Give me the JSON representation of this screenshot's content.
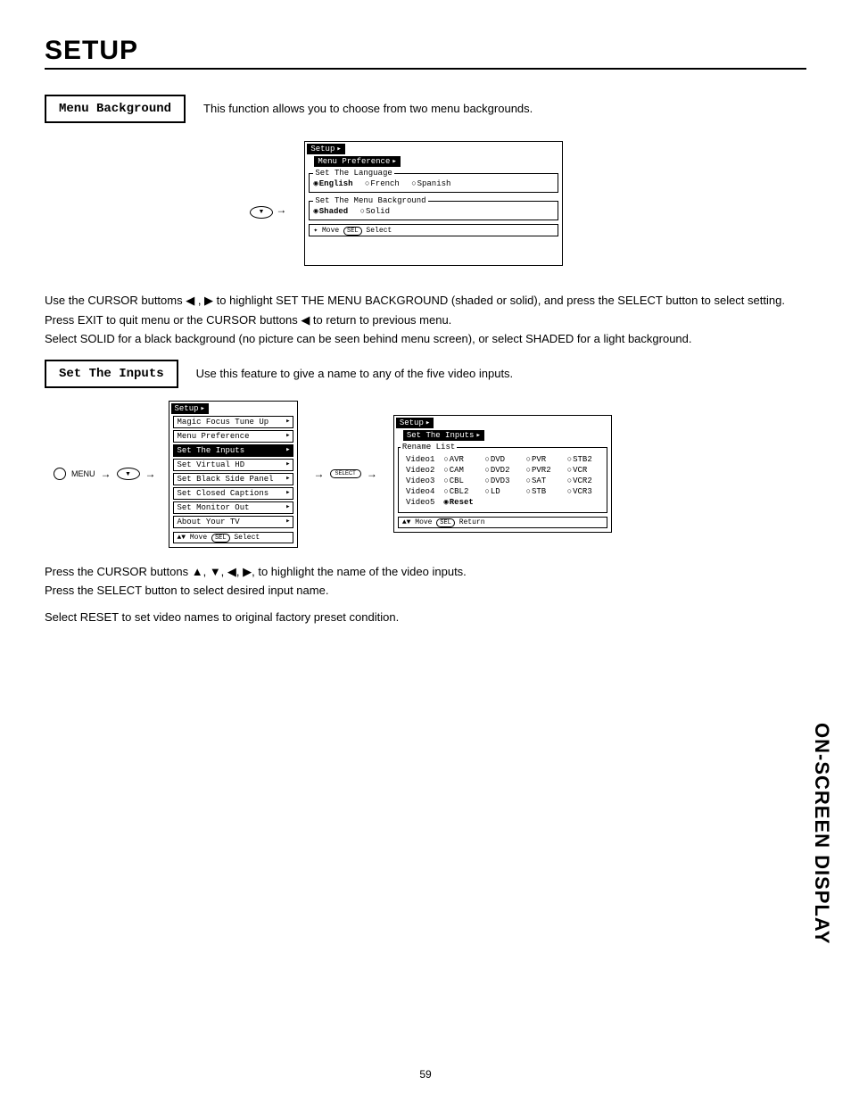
{
  "page_title": "SETUP",
  "section1": {
    "label": "Menu Background",
    "desc": "This function allows you to choose from two menu backgrounds."
  },
  "osd_menu_pref": {
    "title": "Setup",
    "sub": "Menu Preference",
    "lang_legend": "Set The Language",
    "lang": {
      "english": "English",
      "french": "French",
      "spanish": "Spanish"
    },
    "bg_legend": "Set The Menu Background",
    "bg": {
      "shaded": "Shaded",
      "solid": "Solid"
    },
    "footer_move": "Move",
    "footer_sel_btn": "SEL",
    "footer_select": "Select"
  },
  "remote_button": "▼",
  "body1_line1": "Use the CURSOR buttoms ◀ , ▶ to highlight SET THE MENU BACKGROUND (shaded or solid), and press the SELECT button to select setting.",
  "body1_line2": "Press EXIT to quit menu or the CURSOR buttons ◀ to return to previous menu.",
  "body1_line3": "Select SOLID for a black background (no picture can be seen behind menu screen), or select SHADED for a light background.",
  "section2": {
    "label": "Set The Inputs",
    "desc": "Use this feature to give a name to any of the five video inputs."
  },
  "remote_labels": {
    "menu": "MENU",
    "select": "SELECT"
  },
  "osd_setup_list": {
    "title": "Setup",
    "items": [
      "Magic Focus Tune Up",
      "Menu Preference",
      "Set The Inputs",
      "Set Virtual HD",
      "Set Black Side Panel",
      "Set Closed Captions",
      "Set Monitor Out",
      "About Your TV"
    ],
    "active_index": 2,
    "footer_move": "Move",
    "footer_sel_btn": "SEL",
    "footer_select": "Select"
  },
  "osd_rename": {
    "title": "Setup",
    "sub": "Set The Inputs",
    "legend": "Rename List",
    "rows": [
      "Video1",
      "Video2",
      "Video3",
      "Video4",
      "Video5"
    ],
    "grid": [
      [
        "AVR",
        "DVD",
        "PVR",
        "STB2"
      ],
      [
        "CAM",
        "DVD2",
        "PVR2",
        "VCR"
      ],
      [
        "CBL",
        "DVD3",
        "SAT",
        "VCR2"
      ],
      [
        "CBL2",
        "LD",
        "STB",
        "VCR3"
      ]
    ],
    "reset": "Reset",
    "footer_move": "Move",
    "footer_sel_btn": "SEL",
    "footer_return": "Return"
  },
  "body2_line1": "Press the CURSOR buttons ▲, ▼, ◀, ▶, to highlight the name of the video inputs.",
  "body2_line2": "Press the SELECT button to select desired input name.",
  "body2_line3": "Select RESET to set video names to original factory preset condition.",
  "side_label": "ON-SCREEN DISPLAY",
  "page_number": "59"
}
